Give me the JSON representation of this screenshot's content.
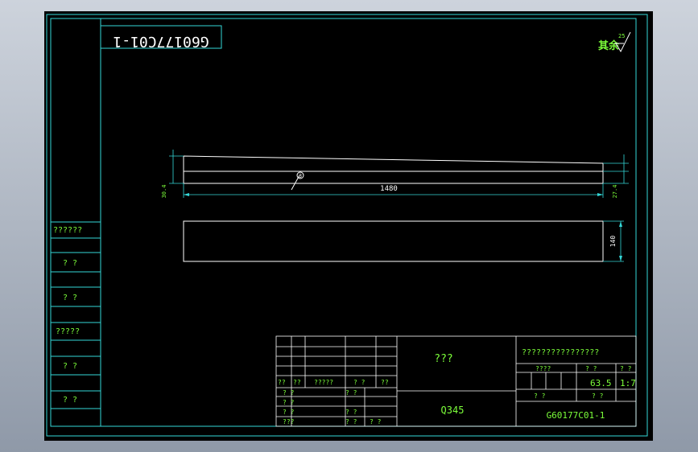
{
  "drawing_number_rotated": "G60177C01-1",
  "roughness": {
    "label": "其余",
    "value": "25"
  },
  "dimensions": {
    "length": "1480",
    "width": "140",
    "left_height": "30.4",
    "right_height": "27.4"
  },
  "weld_symbol": "3",
  "left_column": [
    "??????",
    "? ?",
    "? ?",
    "?????",
    "? ?",
    "? ?"
  ],
  "title_block": {
    "name": "???",
    "material": "Q345",
    "company": "????????????????",
    "stage_label": "????",
    "weight_label": "? ?",
    "scale_label": "? ?",
    "weight": "63.5",
    "scale": "1:7",
    "sheet_left": "?   ?",
    "sheet_right": "?   ?",
    "drawing_no": "G60177C01-1",
    "rev_headers": [
      "??",
      "??",
      "?????",
      "? ?",
      "??"
    ],
    "sign_rows": [
      {
        "a": "? ?",
        "b": "? ?",
        "c": ""
      },
      {
        "a": "? ?",
        "b": "",
        "c": ""
      },
      {
        "a": "? ?",
        "b": "? ?",
        "c": ""
      },
      {
        "a": "???",
        "b": "? ?",
        "c": "? ?"
      }
    ]
  }
}
